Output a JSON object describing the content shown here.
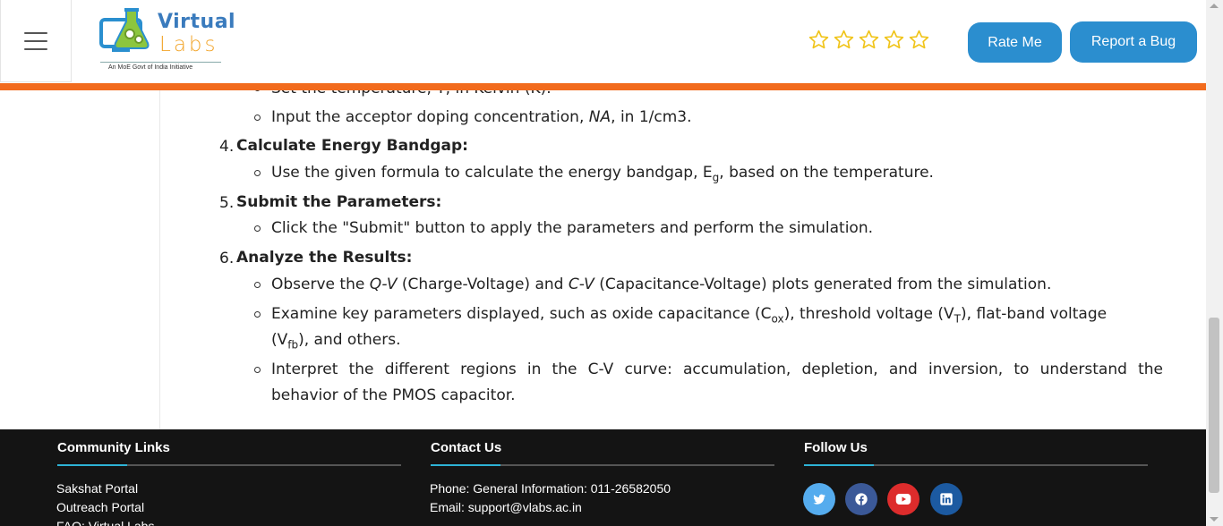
{
  "header": {
    "logo": {
      "word1": "Virtual",
      "word2": "Labs",
      "tagline": "An MoE Govt of India Initiative"
    },
    "rating": {
      "max_stars": 5,
      "filled": 0,
      "star_color": "#f0c419"
    },
    "buttons": {
      "rate": "Rate Me",
      "report": "Report a Bug"
    }
  },
  "content": {
    "cut_text": "Set the temperature, T, in Kelvin (K).",
    "step3_bullet2": {
      "pre": "Input the acceptor doping concentration, ",
      "var": "NA",
      "post": ", in 1/cm3."
    },
    "step4": {
      "num": "4.",
      "title": "Calculate Energy Bandgap:",
      "b1_pre": "Use the given formula to calculate the energy bandgap, E",
      "b1_sub": "g",
      "b1_post": ", based on the temperature."
    },
    "step5": {
      "num": "5.",
      "title": "Submit the Parameters:",
      "b1": "Click the \"Submit\" button to apply the parameters and perform the simulation."
    },
    "step6": {
      "num": "6.",
      "title": "Analyze the Results:",
      "b1_a": "Observe the ",
      "b1_qv": "Q-V",
      "b1_b": " (Charge-Voltage) and ",
      "b1_cv": "C-V",
      "b1_c": " (Capacitance-Voltage) plots generated from the simulation.",
      "b2_l1_a": "Examine key parameters displayed, such as oxide capacitance (C",
      "b2_l1_sub1": "ox",
      "b2_l1_b": "), threshold voltage (V",
      "b2_l1_sub2": "T",
      "b2_l1_c": "), flat-band voltage",
      "b2_l2_a": "(V",
      "b2_l2_sub": "fb",
      "b2_l2_b": "), and others.",
      "b3_l1": "Interpret the different regions in the C-V curve: accumulation, depletion, and inversion, to understand the",
      "b3_l2": "behavior of the PMOS capacitor."
    }
  },
  "footer": {
    "community": {
      "title": "Community Links",
      "links": [
        "Sakshat Portal",
        "Outreach Portal",
        "FAQ: Virtual Labs"
      ]
    },
    "contact": {
      "title": "Contact Us",
      "phone": "Phone: General Information: 011-26582050",
      "email": "Email: support@vlabs.ac.in"
    },
    "follow": {
      "title": "Follow Us",
      "icons": [
        {
          "name": "twitter-icon",
          "color": "#55acee"
        },
        {
          "name": "facebook-icon",
          "color": "#3b5998"
        },
        {
          "name": "youtube-icon",
          "color": "#dd2c2c"
        },
        {
          "name": "linkedin-icon",
          "color": "#1c5aa1"
        }
      ]
    }
  }
}
